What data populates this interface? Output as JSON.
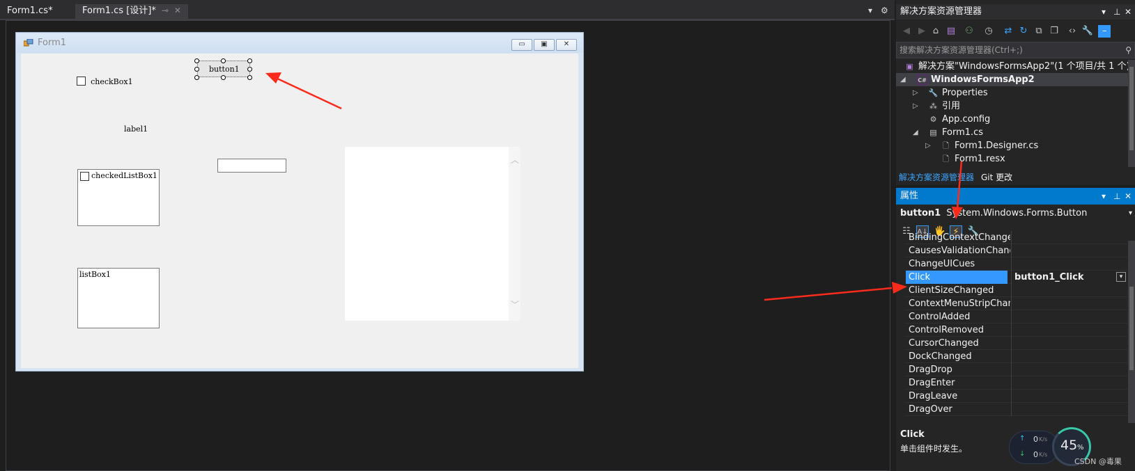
{
  "doc_tabs": [
    {
      "label": "Form1.cs*"
    },
    {
      "label": "Form1.cs [设计]*"
    }
  ],
  "form": {
    "title": "Form1",
    "controls": {
      "checkbox": "checkBox1",
      "button": "button1",
      "label": "label1",
      "checked_list": "checkedListBox1",
      "listbox": "listBox1",
      "textbox": ""
    }
  },
  "solution_explorer": {
    "title": "解决方案资源管理器",
    "search_placeholder": "搜索解决方案资源管理器(Ctrl+;)",
    "tree": [
      {
        "label": "解决方案\"WindowsFormsApp2\"(1 个项目/共 1 个)",
        "icon": "solution-icon"
      },
      {
        "label": "WindowsFormsApp2",
        "icon": "csharp-project-icon"
      },
      {
        "label": "Properties",
        "icon": "wrench-icon"
      },
      {
        "label": "引用",
        "icon": "references-icon"
      },
      {
        "label": "App.config",
        "icon": "config-file-icon"
      },
      {
        "label": "Form1.cs",
        "icon": "form-icon"
      },
      {
        "label": "Form1.Designer.cs",
        "icon": "cs-file-icon"
      },
      {
        "label": "Form1.resx",
        "icon": "resx-file-icon"
      }
    ],
    "bottom_tabs": [
      {
        "label": "解决方案资源管理器"
      },
      {
        "label": "Git 更改"
      }
    ]
  },
  "properties": {
    "title": "属性",
    "object_name": "button1",
    "object_type": "System.Windows.Forms.Button",
    "events": [
      {
        "name": "BindingContextChanged",
        "value": ""
      },
      {
        "name": "CausesValidationChanged",
        "value": ""
      },
      {
        "name": "ChangeUICues",
        "value": ""
      },
      {
        "name": "Click",
        "value": "button1_Click"
      },
      {
        "name": "ClientSizeChanged",
        "value": ""
      },
      {
        "name": "ContextMenuStripChanged",
        "value": ""
      },
      {
        "name": "ControlAdded",
        "value": ""
      },
      {
        "name": "ControlRemoved",
        "value": ""
      },
      {
        "name": "CursorChanged",
        "value": ""
      },
      {
        "name": "DockChanged",
        "value": ""
      },
      {
        "name": "DragDrop",
        "value": ""
      },
      {
        "name": "DragEnter",
        "value": ""
      },
      {
        "name": "DragLeave",
        "value": ""
      },
      {
        "name": "DragOver",
        "value": ""
      }
    ],
    "description_title": "Click",
    "description_text": "单击组件时发生。"
  },
  "net_widget": {
    "upload": "0",
    "download": "0",
    "unit": "K/s",
    "percent": "45",
    "percent_sign": "%"
  },
  "watermark": "CSDN @毒果",
  "colors": {
    "accent": "#007acc",
    "selection": "#3399ff",
    "annotation_arrow": "#ff2b1a"
  }
}
